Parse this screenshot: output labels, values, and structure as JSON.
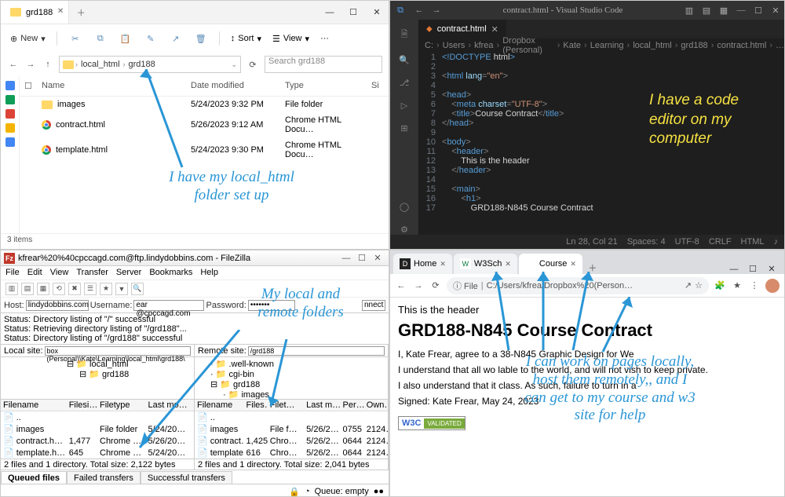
{
  "explorer": {
    "tab_title": "grd188",
    "toolbar": {
      "new": "New",
      "sort": "Sort",
      "view": "View",
      "more": "···"
    },
    "breadcrumbs": [
      "local_html",
      "grd188"
    ],
    "search_placeholder": "Search grd188",
    "columns": {
      "name": "Name",
      "date": "Date modified",
      "type": "Type",
      "size": "Si"
    },
    "rows": [
      {
        "kind": "folder",
        "name": "images",
        "date": "5/24/2023 9:32 PM",
        "type": "File folder"
      },
      {
        "kind": "html",
        "name": "contract.html",
        "date": "5/26/2023 9:12 AM",
        "type": "Chrome HTML Docu…"
      },
      {
        "kind": "html",
        "name": "template.html",
        "date": "5/24/2023 9:30 PM",
        "type": "Chrome HTML Docu…"
      }
    ],
    "status": "3 items"
  },
  "vscode": {
    "title": "contract.html - Visual Studio Code",
    "tab": "contract.html",
    "breadcrumbs": [
      "C:",
      "Users",
      "kfrea",
      "Dropbox (Personal)",
      "Kate",
      "Learning",
      "local_html",
      "grd188",
      "contract.html",
      "…"
    ],
    "lines": [
      {
        "n": 1,
        "segs": [
          [
            "doctype",
            "<!"
          ],
          [
            "tag",
            "DOCTYPE"
          ],
          [
            "text",
            " html"
          ],
          [
            "doctype",
            ">"
          ]
        ]
      },
      {
        "n": 2,
        "segs": []
      },
      {
        "n": 3,
        "segs": [
          [
            "punct",
            "<"
          ],
          [
            "tag",
            "html "
          ],
          [
            "attr",
            "lang"
          ],
          [
            "punct",
            "="
          ],
          [
            "str",
            "\"en\""
          ],
          [
            "punct",
            ">"
          ]
        ]
      },
      {
        "n": 4,
        "segs": []
      },
      {
        "n": 5,
        "segs": [
          [
            "punct",
            "<"
          ],
          [
            "tag",
            "head"
          ],
          [
            "punct",
            ">"
          ]
        ]
      },
      {
        "n": 6,
        "segs": [
          [
            "text",
            "    "
          ],
          [
            "punct",
            "<"
          ],
          [
            "tag",
            "meta "
          ],
          [
            "attr",
            "charset"
          ],
          [
            "punct",
            "="
          ],
          [
            "str",
            "\"UTF-8\""
          ],
          [
            "punct",
            ">"
          ]
        ]
      },
      {
        "n": 7,
        "segs": [
          [
            "text",
            "    "
          ],
          [
            "punct",
            "<"
          ],
          [
            "tag",
            "title"
          ],
          [
            "punct",
            ">"
          ],
          [
            "text",
            "Course Contract"
          ],
          [
            "punct",
            "</"
          ],
          [
            "tag",
            "title"
          ],
          [
            "punct",
            ">"
          ]
        ]
      },
      {
        "n": 8,
        "segs": [
          [
            "punct",
            "</"
          ],
          [
            "tag",
            "head"
          ],
          [
            "punct",
            ">"
          ]
        ]
      },
      {
        "n": 9,
        "segs": []
      },
      {
        "n": 10,
        "segs": [
          [
            "punct",
            "<"
          ],
          [
            "tag",
            "body"
          ],
          [
            "punct",
            ">"
          ]
        ]
      },
      {
        "n": 11,
        "segs": [
          [
            "text",
            "    "
          ],
          [
            "punct",
            "<"
          ],
          [
            "tag",
            "header"
          ],
          [
            "punct",
            ">"
          ]
        ]
      },
      {
        "n": 12,
        "segs": [
          [
            "text",
            "        This is the header"
          ]
        ]
      },
      {
        "n": 13,
        "segs": [
          [
            "text",
            "    "
          ],
          [
            "punct",
            "</"
          ],
          [
            "tag",
            "header"
          ],
          [
            "punct",
            ">"
          ]
        ]
      },
      {
        "n": 14,
        "segs": []
      },
      {
        "n": 15,
        "segs": [
          [
            "text",
            "    "
          ],
          [
            "punct",
            "<"
          ],
          [
            "tag",
            "main"
          ],
          [
            "punct",
            ">"
          ]
        ]
      },
      {
        "n": 16,
        "segs": [
          [
            "text",
            "        "
          ],
          [
            "punct",
            "<"
          ],
          [
            "tag",
            "h1"
          ],
          [
            "punct",
            ">"
          ]
        ]
      },
      {
        "n": 17,
        "segs": [
          [
            "text",
            "            GRD188-N845 Course Contract"
          ]
        ]
      }
    ],
    "status": {
      "pos": "Ln 28, Col 21",
      "spaces": "Spaces: 4",
      "enc": "UTF-8",
      "eol": "CRLF",
      "lang": "HTML",
      "bell": "♪"
    }
  },
  "filezilla": {
    "title": "kfrear%20%40cpccagd.com@ftp.lindydobbins.com - FileZilla",
    "menu": [
      "File",
      "Edit",
      "View",
      "Transfer",
      "Server",
      "Bookmarks",
      "Help"
    ],
    "conn": {
      "host_lbl": "Host:",
      "host": "lindydobbins.com",
      "user_lbl": "Username:",
      "user": "ear @cpccagd.com",
      "pass_lbl": "Password:",
      "connect": "nnect"
    },
    "log": [
      "Status:    Directory listing of \"/\" successful",
      "Status:    Retrieving directory listing of \"/grd188\"...",
      "Status:    Directory listing of \"/grd188\" successful"
    ],
    "local_label": "Local site:",
    "local_path": "box (Personal)\\Kate\\Learning\\local_html\\grd188\\",
    "remote_label": "Remote site:",
    "remote_path": "/grd188",
    "local_tree": [
      "local_html",
      "   grd188"
    ],
    "remote_tree": [
      ".well-known",
      "cgi-bin",
      "grd188",
      "   images"
    ],
    "list_head_local": {
      "name": "Filename",
      "size": "Filesi…",
      "type": "Filetype",
      "mod": "Last mo…"
    },
    "list_head_remote": {
      "name": "Filename",
      "size": "Files…",
      "type": "Filet…",
      "mod": "Last m…",
      "perm": "Per…",
      "own": "Own…"
    },
    "local_rows": [
      {
        "name": "..",
        "size": "",
        "type": "",
        "mod": ""
      },
      {
        "name": "images",
        "size": "",
        "type": "File folder",
        "mod": "5/24/20…"
      },
      {
        "name": "contract.h…",
        "size": "1,477",
        "type": "Chrome …",
        "mod": "5/26/20…"
      },
      {
        "name": "template.h…",
        "size": "645",
        "type": "Chrome …",
        "mod": "5/24/20…"
      }
    ],
    "remote_rows": [
      {
        "name": "..",
        "size": "",
        "type": "",
        "mod": "",
        "perm": "",
        "own": ""
      },
      {
        "name": "images",
        "size": "",
        "type": "File f…",
        "mod": "5/26/2…",
        "perm": "0755",
        "own": "2124…"
      },
      {
        "name": "contract…",
        "size": "1,425",
        "type": "Chro…",
        "mod": "5/26/2…",
        "perm": "0644",
        "own": "2124…"
      },
      {
        "name": "template…",
        "size": "616",
        "type": "Chro…",
        "mod": "5/26/2…",
        "perm": "0644",
        "own": "2124…"
      }
    ],
    "stat_local": "2 files and 1 directory. Total size: 2,122 bytes",
    "stat_remote": "2 files and 1 directory. Total size: 2,041 bytes",
    "queue_tabs": [
      "Queued files",
      "Failed transfers",
      "Successful transfers"
    ],
    "queue_status": "Queue: empty"
  },
  "chrome": {
    "tabs": [
      {
        "fav": "D",
        "favbg": "#222",
        "favcolor": "#fff",
        "label": "Home",
        "active": false
      },
      {
        "fav": "W",
        "favbg": "#fff",
        "favcolor": "#0a7c3a",
        "label": "W3Sch",
        "active": false
      },
      {
        "fav": "",
        "favbg": "#fff",
        "favcolor": "#555",
        "label": "Course",
        "active": true
      }
    ],
    "omnibox_prefix": "ⓘ  File",
    "omnibox_url": "C:/Users/kfrea/Dropbox%20(Person…",
    "page": {
      "header_line": "This is the header",
      "h1": "GRD188-N845 Course Contract",
      "p1": "I, Kate Frear, agree to a                                                                                                38-N845 Graphic Design for We",
      "p2": "I understand that all wo                                                                                                 lable to the world, and will not                                                                                                vish to keep private.",
      "p3": "I also understand that it                                                                                                class. As such, failure to turn in a",
      "signed": "Signed: Kate Frear, May 24, 2023",
      "w3l": "W3C",
      "w3r": "VALIDATED"
    }
  },
  "annotations": {
    "explorer": "I have my local_html\nfolder set up",
    "vscode": "I have a code\neditor on my\ncomputer",
    "filezilla": "My local and\nremote folders",
    "chrome": "I can work on pages locally,\nhost them remotely,, and I\ncan get to my course and w3\nsite for help"
  }
}
